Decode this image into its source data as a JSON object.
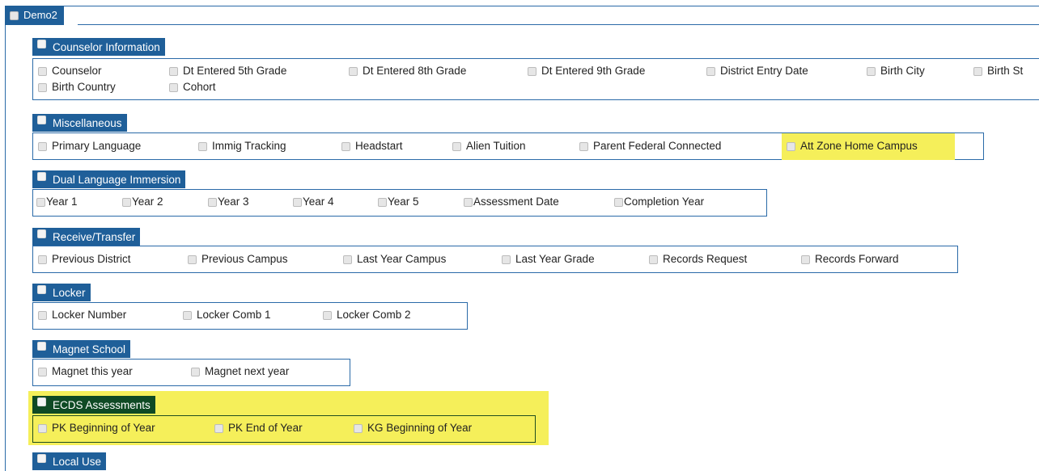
{
  "root": {
    "label": "Demo2"
  },
  "groups": [
    {
      "title": "Counselor Information",
      "items": [
        "Counselor",
        "Dt Entered 5th Grade",
        "Dt Entered 8th Grade",
        "Dt Entered 9th Grade",
        "District Entry Date",
        "Birth City",
        "Birth St",
        "Birth Country",
        "Cohort"
      ]
    },
    {
      "title": "Miscellaneous",
      "items": [
        "Primary Language",
        "Immig Tracking",
        "Headstart",
        "Alien Tuition",
        "Parent Federal Connected",
        "Att Zone Home Campus"
      ],
      "highlighted": [
        "Att Zone Home Campus"
      ]
    },
    {
      "title": "Dual Language Immersion",
      "items": [
        "Year 1",
        "Year 2",
        "Year 3",
        "Year 4",
        "Year 5",
        "Assessment Date",
        "Completion Year"
      ]
    },
    {
      "title": "Receive/Transfer",
      "items": [
        "Previous District",
        "Previous Campus",
        "Last Year Campus",
        "Last Year Grade",
        "Records Request",
        "Records Forward"
      ]
    },
    {
      "title": "Locker",
      "items": [
        "Locker Number",
        "Locker Comb 1",
        "Locker Comb 2"
      ]
    },
    {
      "title": "Magnet School",
      "items": [
        "Magnet this year",
        "Magnet next year"
      ]
    },
    {
      "title": "ECDS Assessments",
      "items": [
        "PK Beginning of Year",
        "PK End of Year",
        "KG Beginning of Year"
      ],
      "highlighted_group": true
    },
    {
      "title": "Local Use",
      "items": []
    }
  ],
  "colors": {
    "header": "#1f5f99",
    "border": "#2a6aa8",
    "highlight": "#f5ef5a"
  }
}
